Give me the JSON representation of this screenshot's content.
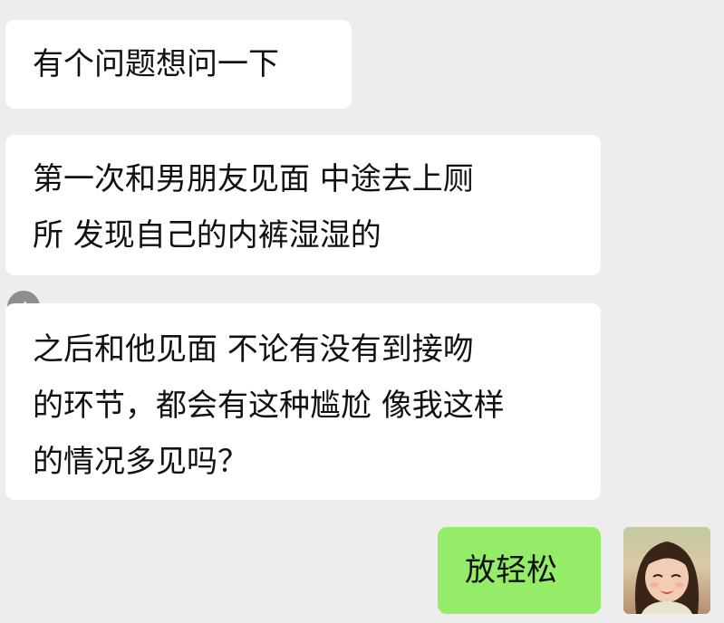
{
  "messages": [
    {
      "side": "incoming",
      "lines": [
        "有个问题想问一下"
      ]
    },
    {
      "side": "incoming",
      "lines": [
        "第一次和男朋友见面 中途去上厕",
        "所 发现自己的内裤湿湿的"
      ]
    },
    {
      "side": "incoming",
      "lines": [
        "之后和他见面 不论有没有到接吻",
        "的环节，都会有这种尴尬 像我这样",
        "的情况多见吗？"
      ]
    },
    {
      "side": "outgoing",
      "lines": [
        "放轻松"
      ]
    }
  ],
  "colors": {
    "background": "#ededed",
    "incoming_bubble": "#ffffff",
    "outgoing_bubble": "#95ec69"
  },
  "icons": {
    "back": "chevron-left-icon",
    "avatar": "user-avatar-photo"
  }
}
